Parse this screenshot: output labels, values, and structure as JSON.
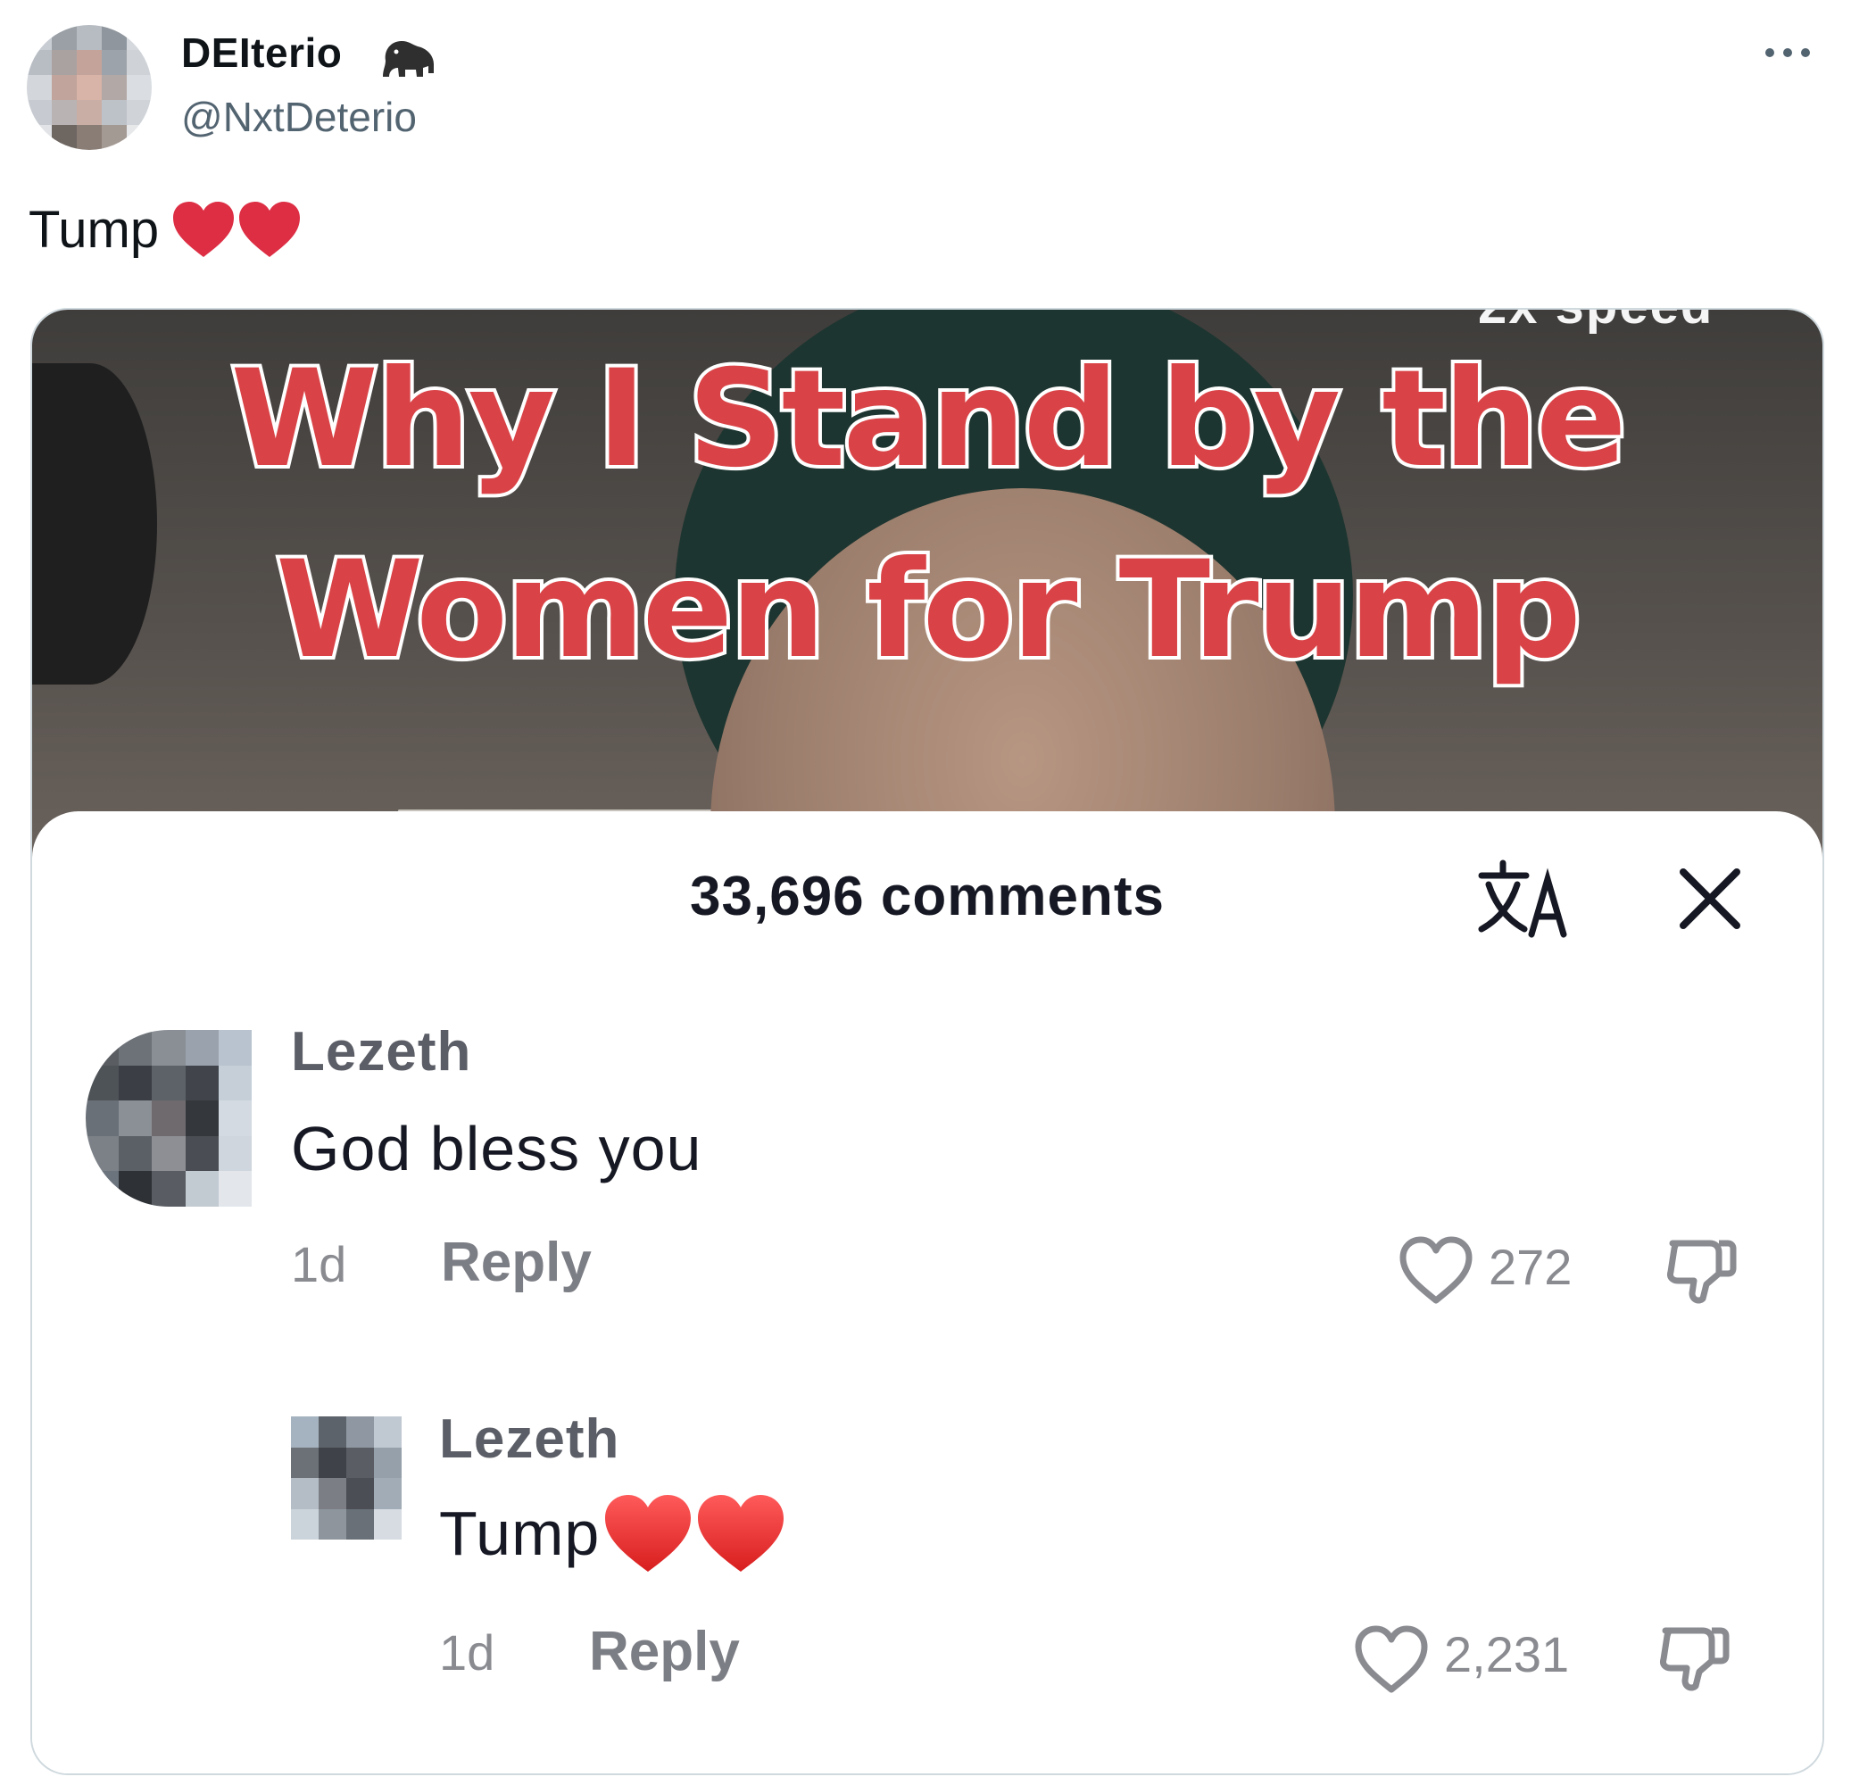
{
  "tweet": {
    "display_name": "DEIterio",
    "handle": "@NxtDeterio",
    "text": "Tump",
    "name_badge_icon": "gorilla-icon",
    "text_emojis": [
      "red-heart-emoji",
      "red-heart-emoji"
    ]
  },
  "media": {
    "partial_caption": "2x speed",
    "title_line_1": "Why I Stand by the",
    "title_line_2": "Women for Trump",
    "comments_header": "33,696 comments",
    "comments": [
      {
        "user": "Lezeth",
        "text": "God bless you",
        "time": "1d",
        "reply_label": "Reply",
        "likes": "272"
      },
      {
        "user": "Lezeth",
        "text": "Tump",
        "emojis": [
          "red-heart-emoji",
          "red-heart-emoji"
        ],
        "time": "1d",
        "reply_label": "Reply",
        "likes": "2,231"
      }
    ]
  },
  "colors": {
    "title_red": "#d94347",
    "heart_red": "#dd2e44",
    "handle_gray": "#536471",
    "comment_gray": "#8a8b91"
  }
}
